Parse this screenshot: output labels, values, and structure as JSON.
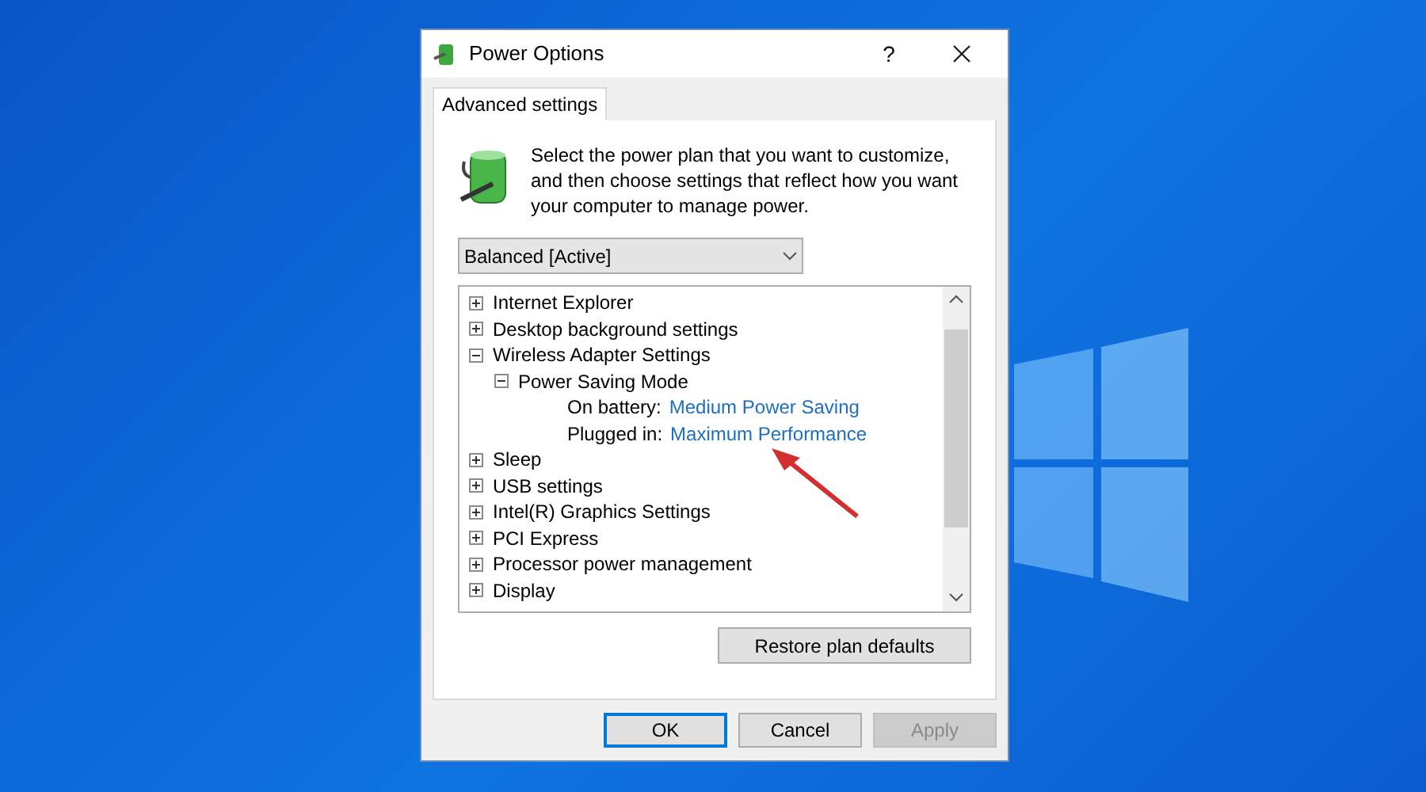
{
  "window": {
    "title": "Power Options",
    "help": "?"
  },
  "tabs": [
    {
      "label": "Advanced settings",
      "selected": true
    }
  ],
  "description": "Select the power plan that you want to customize, and then choose settings that reflect how you want your computer to manage power.",
  "plan_dropdown": {
    "value": "Balanced [Active]"
  },
  "tree": [
    {
      "label": "Internet Explorer",
      "expanded": false
    },
    {
      "label": "Desktop background settings",
      "expanded": false
    },
    {
      "label": "Wireless Adapter Settings",
      "expanded": true,
      "children": [
        {
          "label": "Power Saving Mode",
          "expanded": true,
          "children": [
            {
              "kind": "setting",
              "label": "On battery:",
              "value": "Medium Power Saving"
            },
            {
              "kind": "setting",
              "label": "Plugged in:",
              "value": "Maximum Performance"
            }
          ]
        }
      ]
    },
    {
      "label": "Sleep",
      "expanded": false
    },
    {
      "label": "USB settings",
      "expanded": false
    },
    {
      "label": "Intel(R) Graphics Settings",
      "expanded": false
    },
    {
      "label": "PCI Express",
      "expanded": false
    },
    {
      "label": "Processor power management",
      "expanded": false
    },
    {
      "label": "Display",
      "expanded": false
    }
  ],
  "restore_button": "Restore plan defaults",
  "buttons": [
    {
      "label": "OK",
      "default": true,
      "disabled": false
    },
    {
      "label": "Cancel",
      "default": false,
      "disabled": false
    },
    {
      "label": "Apply",
      "default": false,
      "disabled": true
    }
  ]
}
